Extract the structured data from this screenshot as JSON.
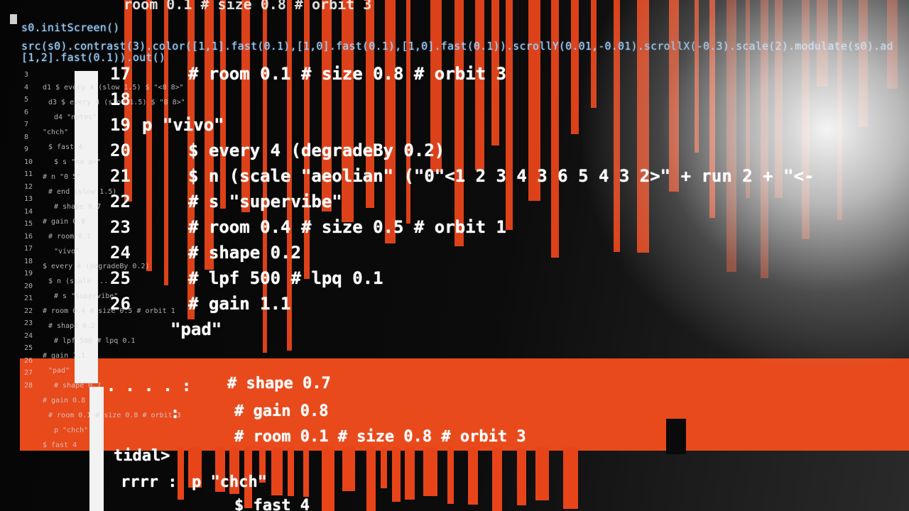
{
  "hydra": {
    "line1": "s0.initScreen()",
    "line2": "src(s0).contrast(3).color([1,1].fast(0.1),[1,0].fast(0.1),[1,0].fast(0.1)).scrollY(0.01,-0.01).scrollX(-0.3).scale(2).modulate(s0).ad",
    "line3": "[1,2].fast(0.1)).out()"
  },
  "top_garble": "  room 0.1 # size 0.8 # orbit 3",
  "code_lines": [
    {
      "num": "17",
      "text": "# room 0.1 # size 0.8 # orbit 3"
    },
    {
      "num": "18",
      "text": ""
    },
    {
      "num": "19",
      "text": "p \"vivo\""
    },
    {
      "num": "20",
      "text": "$ every 4 (degradeBy 0.2)"
    },
    {
      "num": "21",
      "text": "$ n (scale \"aeolian\" (\"0\"<1 2 3 4 3 6 5 4 3 2>\" + run 2 + \"<-"
    },
    {
      "num": "22",
      "text": "# s \"supervibe\""
    },
    {
      "num": "23",
      "text": "# room 0.4 # size 0.5 # orbit 1"
    },
    {
      "num": "24",
      "text": "# shape 0.2"
    },
    {
      "num": "25",
      "text": "# lpf 500 # lpq 0.1"
    },
    {
      "num": "26",
      "text": "# gain 1.1"
    },
    {
      "num": "",
      "text": "\"pad\""
    }
  ],
  "lower_lines": [
    {
      "text": "# shape 0.7"
    },
    {
      "text": "# gain 0.8"
    },
    {
      "text": "# room 0.1 # size 0.8 # orbit 3"
    },
    {
      "text": "tidal>"
    },
    {
      "text": "p \"chch\""
    },
    {
      "text": "$ fast 4"
    }
  ],
  "lower_prefix": {
    "dots": ". . . . :",
    "colon": ":",
    "rrrr": "rrrr :"
  },
  "gutter": {
    "nums": [
      "3",
      "4",
      "5",
      "6",
      "7",
      "8",
      "9",
      "10",
      "11",
      "12",
      "13",
      "14",
      "15",
      "16",
      "17",
      "18",
      "19",
      "20",
      "21",
      "22",
      "23",
      "24",
      "25",
      "26",
      "27",
      "28"
    ],
    "mini_lines": [
      "d1 $ every 4 (slow 1.5) $ \"<8 8>\"",
      "d3 $ every 4 (slow 1.5) $ \"8 8>\"",
      "d4 \"notes\"",
      "\"chch\"",
      "$ fast 4",
      "$ s \"<a a>\"",
      "# n \"0 5\"",
      "# end (slow 1.5)",
      "# shape 0.7",
      "# gain 0.8",
      "# room 0.1",
      "\"vivo\"",
      "$ every 4 (degradeBy 0.2)",
      "$ n (scale ...",
      "# s \"supervibe\"",
      "# room 0.4 # size 0.5 # orbit 1",
      "# shape 0.2",
      "# lpf 500 # lpq 0.1",
      "# gain 1.1",
      "\"pad\"",
      "# shape 0.7",
      "# gain 0.8",
      "# room 0.1 # size 0.8 # orbit 3",
      "p \"chch\"",
      "$ fast 4"
    ]
  },
  "colors": {
    "accent": "#e8441a",
    "text": "#ffffff",
    "hydra_text": "#9fd2ff",
    "background": "#0a0a0a"
  }
}
